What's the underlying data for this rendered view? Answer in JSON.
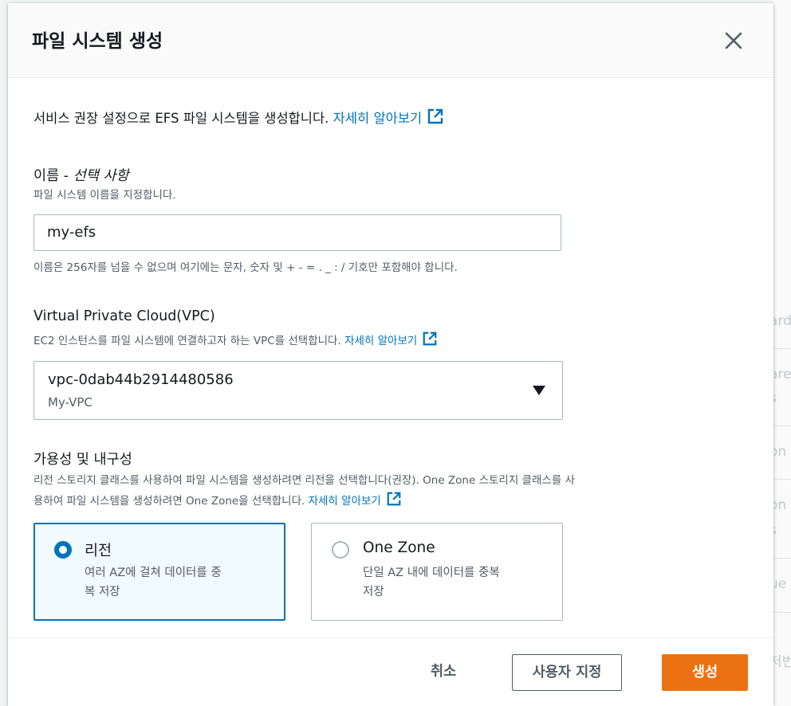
{
  "background": {
    "fragments": [
      "ard",
      "are",
      "s",
      "on",
      "on",
      "s",
      "ue",
      "저번"
    ]
  },
  "modal": {
    "title": "파일 시스템 생성",
    "close_icon": "close-icon"
  },
  "intro": {
    "text": "서비스 권장 설정으로 EFS 파일 시스템을 생성합니다.",
    "link": "자세히 알아보기"
  },
  "name_field": {
    "label": "이름 -",
    "label_optional": "선택 사항",
    "description": "파일 시스템 이름을 지정합니다.",
    "value": "my-efs",
    "constraint": "이름은 256자를 넘을 수 없으며 여기에는 문자, 숫자 및 + - = . _ : / 기호만 포함해야 합니다."
  },
  "vpc_field": {
    "label": "Virtual Private Cloud(VPC)",
    "description": "EC2 인스턴스를 파일 시스템에 연결하고자 하는 VPC를 선택합니다.",
    "link": "자세히 알아보기",
    "selected_value": "vpc-0dab44b2914480586",
    "selected_sub": "My-VPC"
  },
  "durability_field": {
    "label": "가용성 및 내구성",
    "description_line1": "리전 스토리지 클래스를 사용하여 파일 시스템을 생성하려면 리전을 선택합니다(권장). One Zone 스토리지 클래스를 사",
    "description_line2": "용하여 파일 시스템을 생성하려면 One Zone을 선택합니다.",
    "link": "자세히 알아보기",
    "options": [
      {
        "title": "리전",
        "desc_line1": "여러 AZ에 걸쳐 데이터를 중",
        "desc_line2": "복 저장",
        "selected": true
      },
      {
        "title": "One Zone",
        "desc_line1": "단일 AZ 내에 데이터를 중복",
        "desc_line2": "저장",
        "selected": false
      }
    ]
  },
  "footer": {
    "cancel_label": "취소",
    "customize_label": "사용자 지정",
    "create_label": "생성"
  },
  "colors": {
    "link": "#0073bb",
    "primary": "#ec7211",
    "selected_tile_bg": "#f1faff",
    "border": "#aab7b8"
  }
}
